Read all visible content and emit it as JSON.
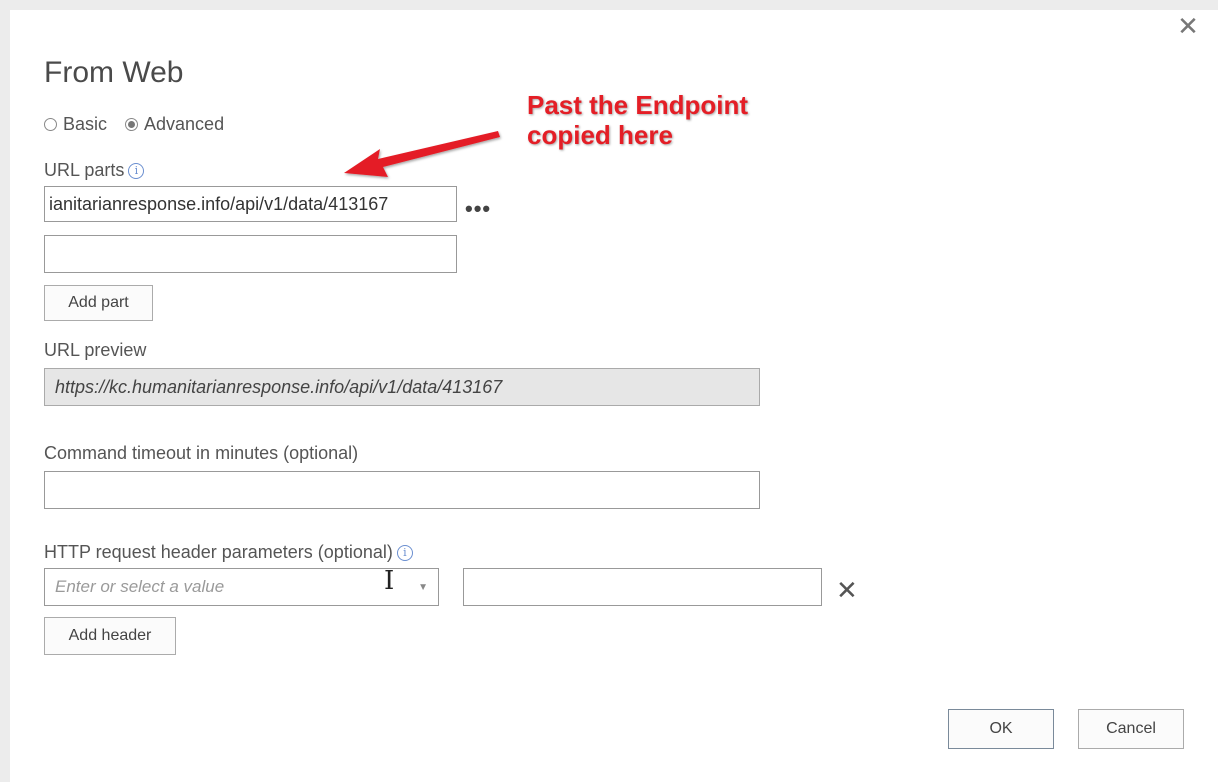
{
  "dialog": {
    "title": "From Web",
    "close_icon": "close-icon"
  },
  "mode": {
    "options": [
      {
        "label": "Basic",
        "selected": false
      },
      {
        "label": "Advanced",
        "selected": true
      }
    ]
  },
  "url_parts": {
    "label": "URL parts",
    "info_icon": "info-icon",
    "part1_value": "ianitarianresponse.info/api/v1/data/413167",
    "part2_value": "",
    "more_icon": "ellipsis-icon",
    "add_part_label": "Add part"
  },
  "url_preview": {
    "label": "URL preview",
    "value": "https://kc.humanitarianresponse.info/api/v1/data/413167"
  },
  "timeout": {
    "label": "Command timeout in minutes (optional)",
    "value": ""
  },
  "headers": {
    "label": "HTTP request header parameters (optional)",
    "info_icon": "info-icon",
    "name_placeholder": "Enter or select a value",
    "dropdown_icon": "chevron-down-icon",
    "value": "",
    "remove_icon": "close-icon",
    "add_header_label": "Add header"
  },
  "footer": {
    "ok_label": "OK",
    "cancel_label": "Cancel"
  },
  "annotation": {
    "line1": "Past the Endpoint",
    "line2": "copied here",
    "color": "#e41e26"
  }
}
